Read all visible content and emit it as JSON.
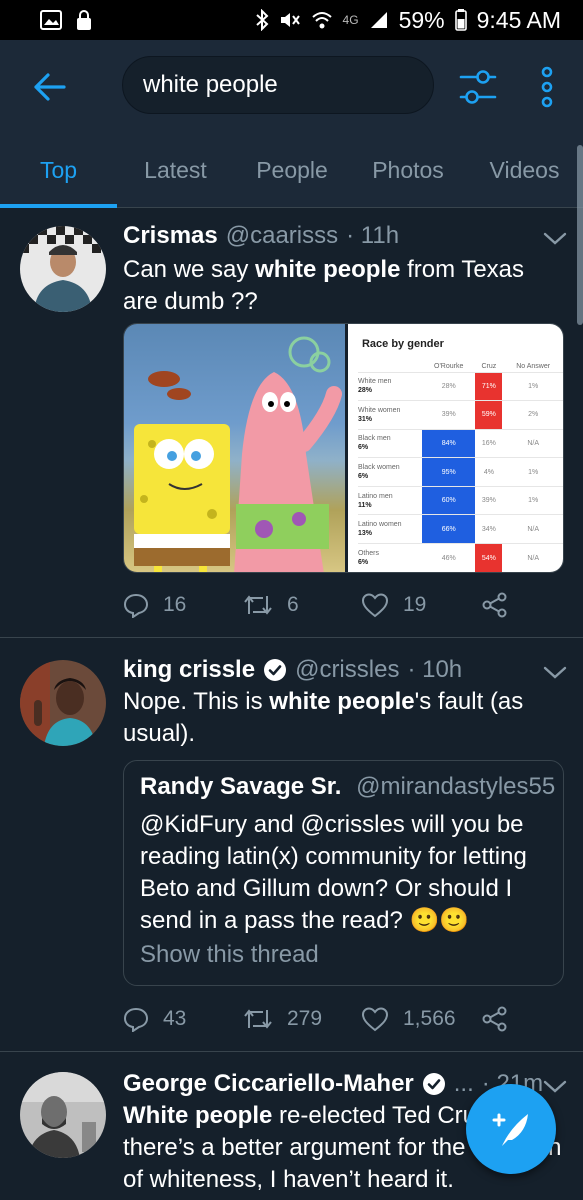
{
  "statusbar": {
    "network_label": "4G",
    "battery": "59%",
    "time": "9:45 AM"
  },
  "search": {
    "query": "white people"
  },
  "tabs": [
    {
      "label": "Top",
      "active": true
    },
    {
      "label": "Latest",
      "active": false
    },
    {
      "label": "People",
      "active": false
    },
    {
      "label": "Photos",
      "active": false
    },
    {
      "label": "Videos",
      "active": false
    }
  ],
  "tweets": [
    {
      "name": "Crismas",
      "handle": "@caarisss",
      "time": "· 11h",
      "text_parts": [
        "Can we say ",
        "white people",
        " from Texas are dumb ??"
      ],
      "replies": "16",
      "retweets": "6",
      "likes": "19",
      "chart": {
        "title": "Race by gender",
        "columns": [
          "O'Rourke",
          "Cruz",
          "No Answer"
        ],
        "rows": [
          {
            "label": "White men",
            "share": "28%",
            "values": [
              "28%",
              "71%",
              "1%"
            ]
          },
          {
            "label": "White women",
            "share": "31%",
            "values": [
              "39%",
              "59%",
              "2%"
            ]
          },
          {
            "label": "Black men",
            "share": "6%",
            "values": [
              "84%",
              "16%",
              "N/A"
            ]
          },
          {
            "label": "Black women",
            "share": "6%",
            "values": [
              "95%",
              "4%",
              "1%"
            ]
          },
          {
            "label": "Latino men",
            "share": "11%",
            "values": [
              "60%",
              "39%",
              "1%"
            ]
          },
          {
            "label": "Latino women",
            "share": "13%",
            "values": [
              "66%",
              "34%",
              "N/A"
            ]
          },
          {
            "label": "Others",
            "share": "6%",
            "values": [
              "46%",
              "54%",
              "N/A"
            ]
          }
        ]
      }
    },
    {
      "name": "king crissle",
      "handle": "@crissles",
      "time": "· 10h",
      "text_parts": [
        "Nope. This is ",
        "white people",
        "'s fault (as usual)."
      ],
      "replies": "43",
      "retweets": "279",
      "likes": "1,566",
      "quote": {
        "name": "Randy Savage Sr.",
        "handle": "@mirandastyles55",
        "text": "@KidFury and @crissles will you be reading latin(x) community for letting Beto and Gillum down? Or should I send in a pass the read? 🙂🙂",
        "thread_link": "Show this thread"
      }
    },
    {
      "name": "George Ciccariello-Maher",
      "handle": "...",
      "time": "· 21m",
      "text_parts": [
        "",
        "White people",
        " re-elected Ted Cruz. If there’s a better argument for the abolition of whiteness, I haven’t heard it."
      ]
    }
  ]
}
